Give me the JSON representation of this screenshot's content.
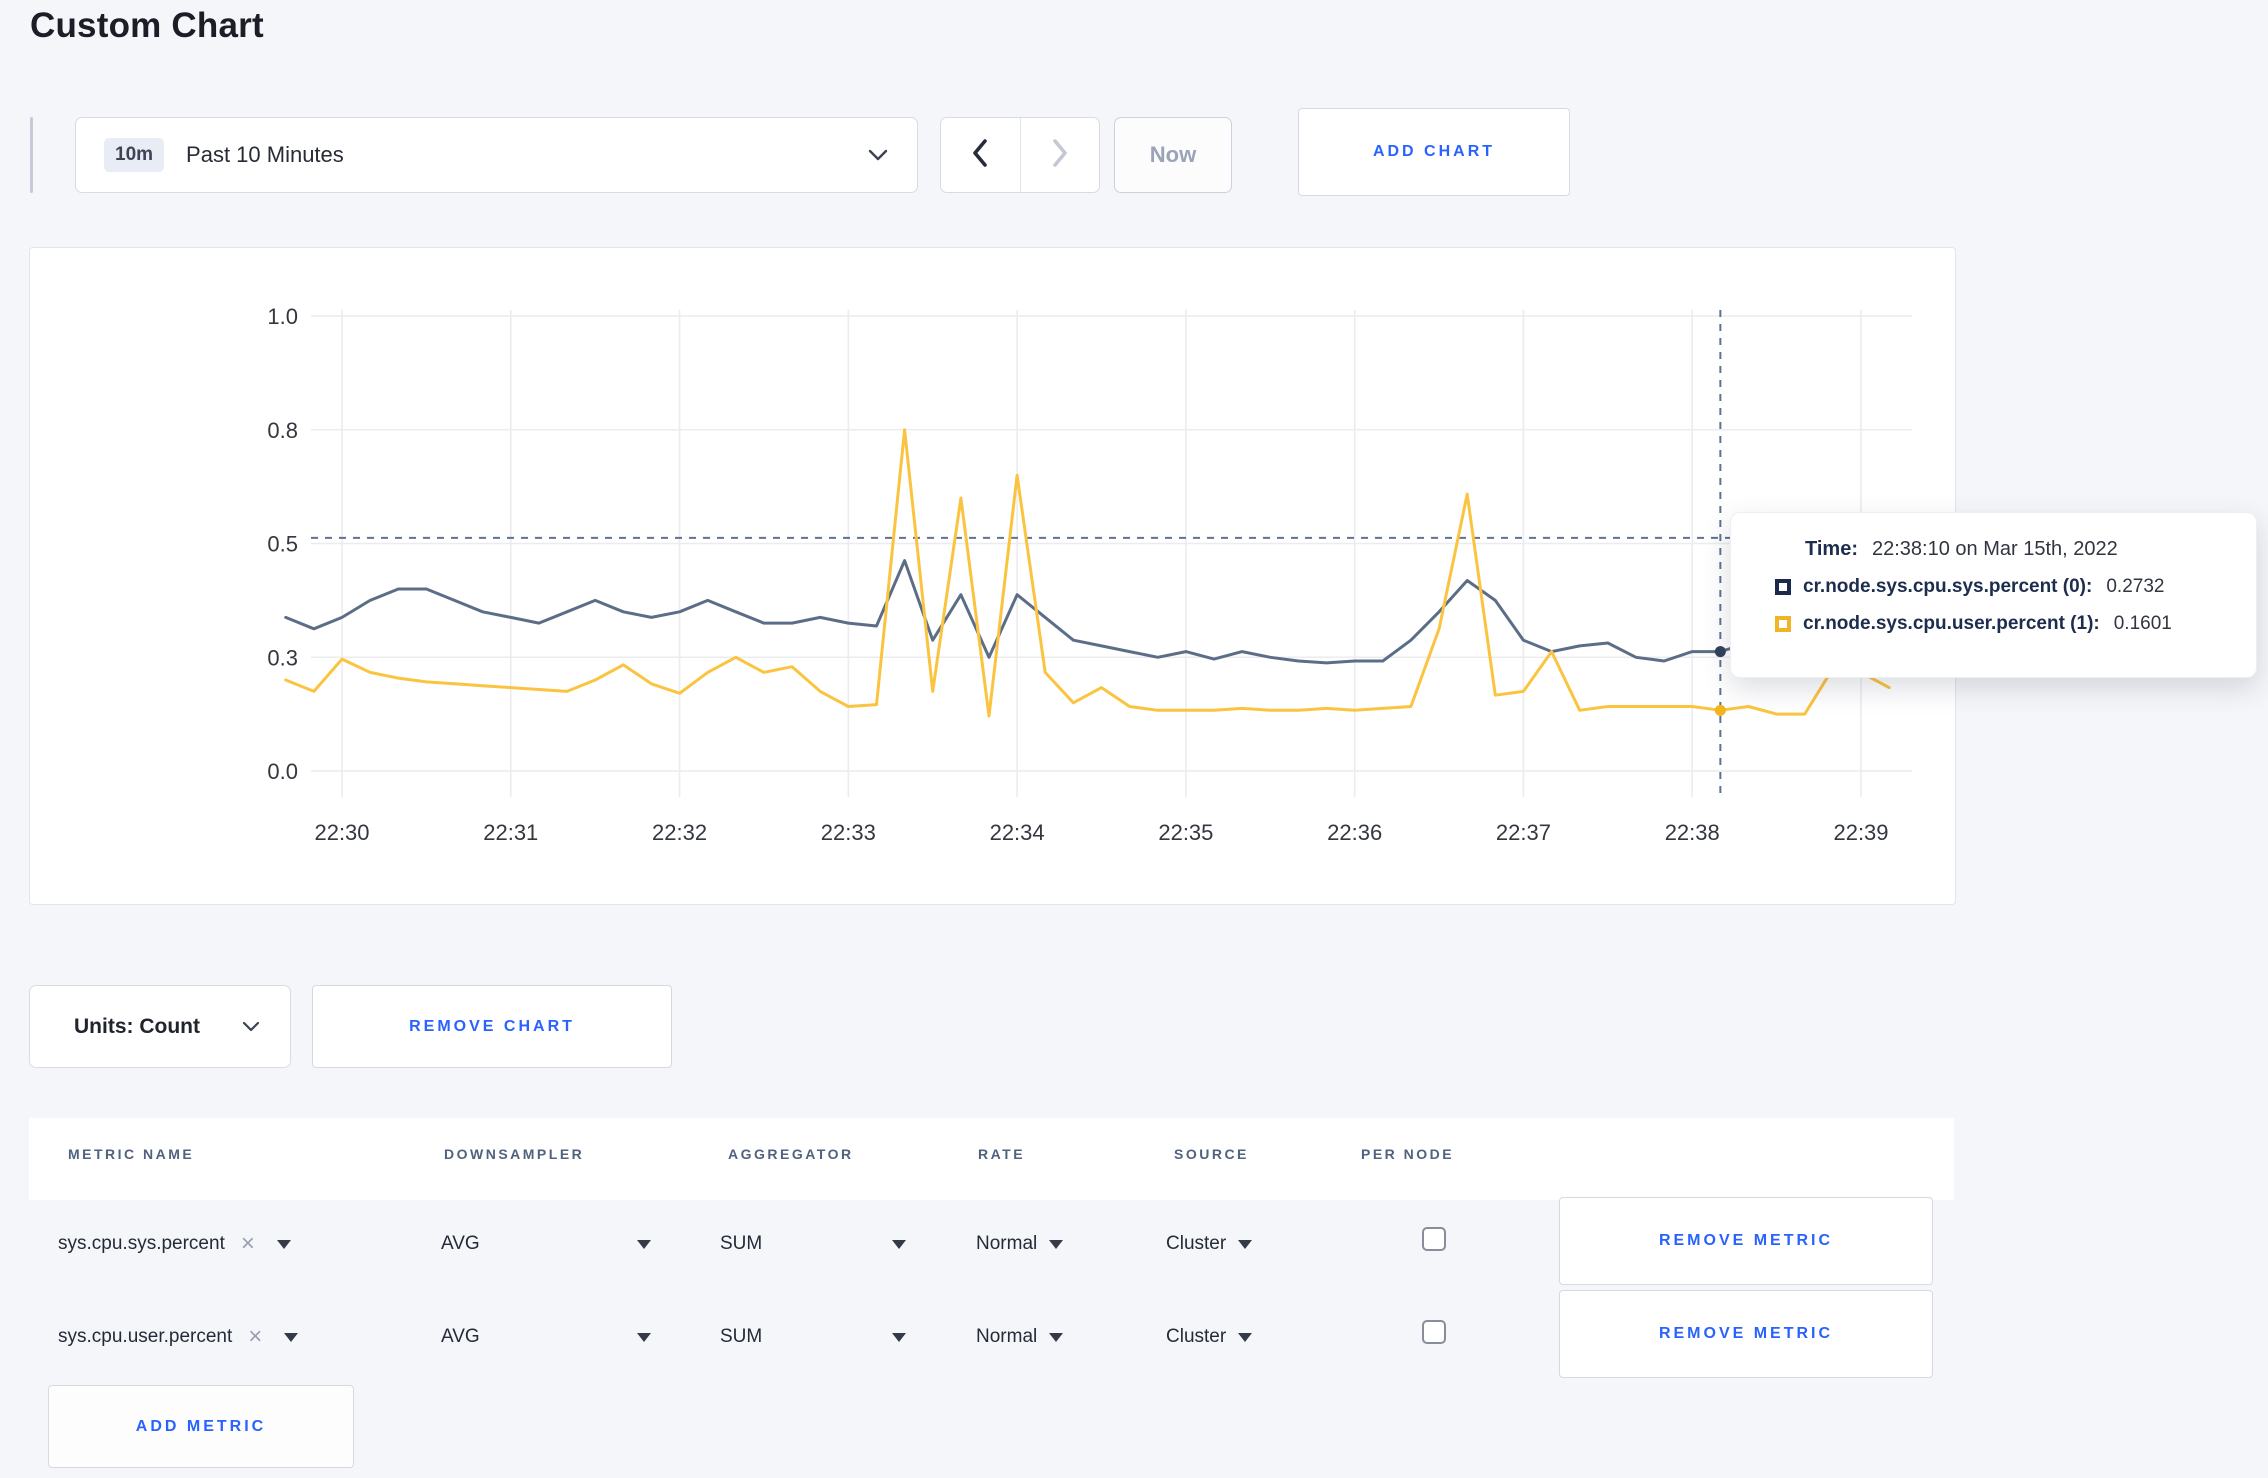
{
  "page": {
    "title": "Custom Chart"
  },
  "toolbar": {
    "range_badge": "10m",
    "range_label": "Past 10 Minutes",
    "prev_icon": "chevron-left",
    "next_icon": "chevron-right",
    "now_label": "Now",
    "add_chart_label": "ADD CHART"
  },
  "chart_data": {
    "type": "line",
    "title": "Custom Chart",
    "x_tick_labels": [
      "22:30",
      "22:31",
      "22:32",
      "22:33",
      "22:34",
      "22:35",
      "22:36",
      "22:37",
      "22:38",
      "22:39"
    ],
    "y_tick_labels": [
      "0.0",
      "0.3",
      "0.5",
      "0.8",
      "1.0"
    ],
    "y_tick_values": [
      0,
      0.3,
      0.5,
      0.8,
      1.0
    ],
    "y_axis_note": "ticks evenly spaced (non-linear value scale)",
    "grid": true,
    "x_start": "22:29:40",
    "x_end": "22:39:10",
    "x_interval_seconds": 10,
    "series": [
      {
        "name": "cr.node.sys.cpu.sys.percent",
        "color": "#5c6e87",
        "marker_color": "#32415d",
        "values": [
          0.37,
          0.35,
          0.37,
          0.4,
          0.42,
          0.42,
          0.4,
          0.38,
          0.37,
          0.36,
          0.38,
          0.4,
          0.38,
          0.37,
          0.38,
          0.4,
          0.38,
          0.36,
          0.36,
          0.37,
          0.36,
          0.355,
          0.47,
          0.33,
          0.41,
          0.3,
          0.41,
          0.37,
          0.33,
          0.32,
          0.31,
          0.3,
          0.31,
          0.295,
          0.31,
          0.3,
          0.29,
          0.285,
          0.29,
          0.29,
          0.33,
          0.38,
          0.435,
          0.4,
          0.33,
          0.31,
          0.32,
          0.325,
          0.3,
          0.29,
          0.31,
          0.31,
          0.325,
          0.3,
          0.3,
          0.3,
          0.305,
          0.33
        ]
      },
      {
        "name": "cr.node.sys.cpu.user.percent",
        "color": "#fbc440",
        "marker_color": "#f2b31c",
        "values": [
          0.24,
          0.21,
          0.295,
          0.26,
          0.245,
          0.235,
          0.23,
          0.225,
          0.22,
          0.215,
          0.21,
          0.24,
          0.28,
          0.23,
          0.205,
          0.26,
          0.3,
          0.26,
          0.275,
          0.21,
          0.17,
          0.175,
          0.8,
          0.21,
          0.62,
          0.145,
          0.68,
          0.26,
          0.18,
          0.22,
          0.17,
          0.16,
          0.16,
          0.16,
          0.165,
          0.16,
          0.16,
          0.165,
          0.16,
          0.165,
          0.17,
          0.35,
          0.63,
          0.2,
          0.21,
          0.31,
          0.16,
          0.17,
          0.17,
          0.17,
          0.17,
          0.16,
          0.17,
          0.15,
          0.15,
          0.27,
          0.26,
          0.22
        ]
      }
    ],
    "crosshair": {
      "time": "22:38:10",
      "h_line_value": 0.515
    },
    "colors": {
      "grid": "#ebecef",
      "axis_text": "#33373f",
      "dashed": "#5d7292"
    },
    "legend_position": "tooltip"
  },
  "tooltip": {
    "time_label": "Time:",
    "time_value": "22:38:10 on Mar 15th, 2022",
    "rows": [
      {
        "label": "cr.node.sys.cpu.sys.percent (0):",
        "value": "0.2732",
        "color": "#1b2a4a"
      },
      {
        "label": "cr.node.sys.cpu.user.percent (1):",
        "value": "0.1601",
        "color": "#f0b429"
      }
    ]
  },
  "chart_footer": {
    "units_label": "Units: Count",
    "remove_chart_label": "REMOVE CHART"
  },
  "metrics_table": {
    "headers": [
      "METRIC NAME",
      "DOWNSAMPLER",
      "AGGREGATOR",
      "RATE",
      "SOURCE",
      "PER NODE"
    ],
    "rows": [
      {
        "metric": "sys.cpu.sys.percent",
        "downsampler": "AVG",
        "aggregator": "SUM",
        "rate": "Normal",
        "source": "Cluster",
        "per_node_checked": false,
        "remove_label": "REMOVE METRIC"
      },
      {
        "metric": "sys.cpu.user.percent",
        "downsampler": "AVG",
        "aggregator": "SUM",
        "rate": "Normal",
        "source": "Cluster",
        "per_node_checked": false,
        "remove_label": "REMOVE METRIC"
      }
    ],
    "add_metric_label": "ADD METRIC"
  }
}
